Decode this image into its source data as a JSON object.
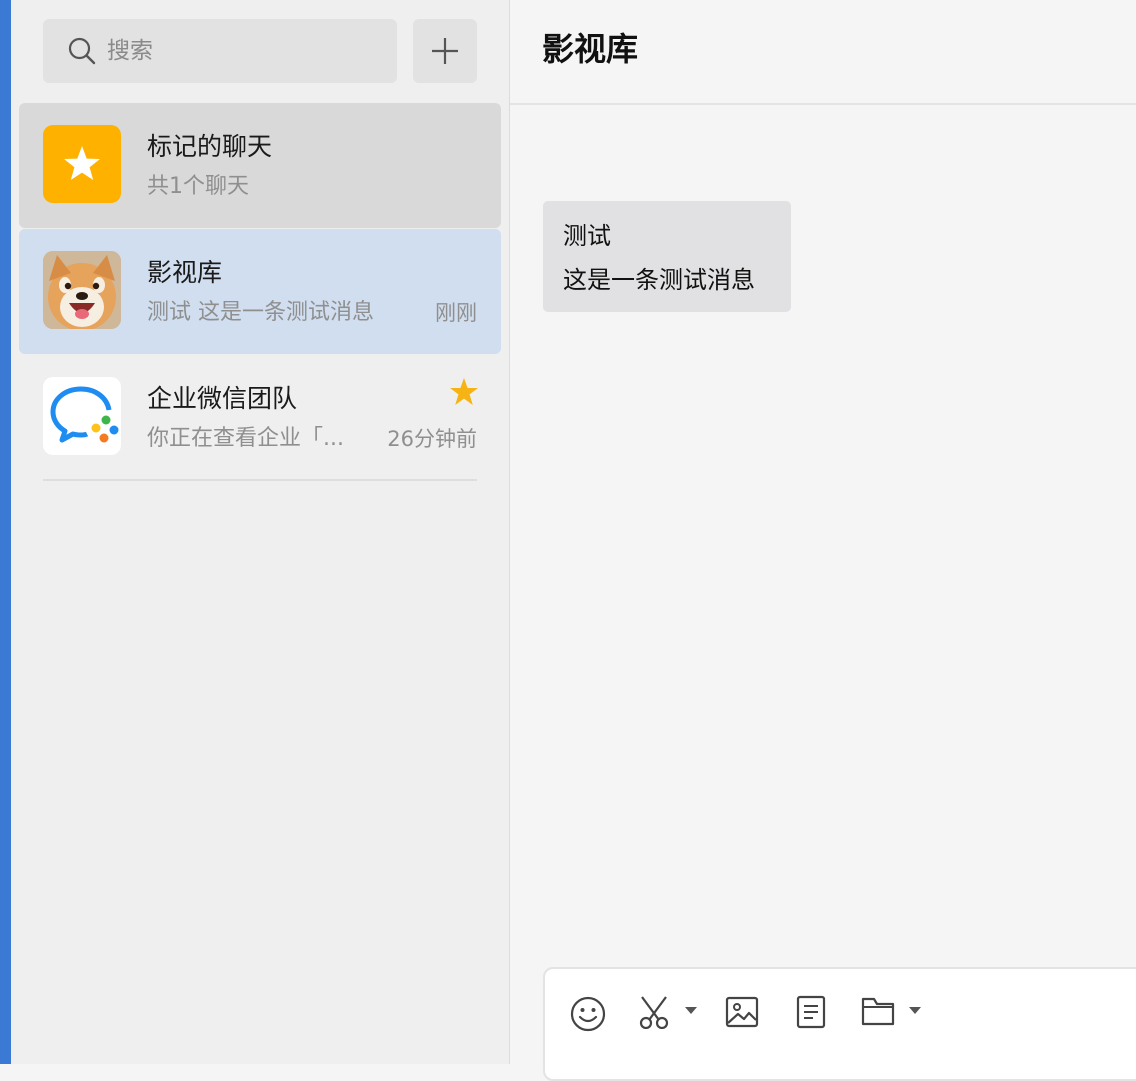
{
  "search": {
    "placeholder": "搜索",
    "icon": "search-icon"
  },
  "add_button": {
    "icon": "plus-icon"
  },
  "conversations": [
    {
      "title": "标记的聊天",
      "subtitle": "共1个聊天",
      "time": "",
      "avatar": "star-folder-icon",
      "avatar_color": "#ffb100",
      "state": "marked"
    },
    {
      "title": "影视库",
      "subtitle": "测试 这是一条测试消息",
      "time": "刚刚",
      "avatar": "shiba-dog-avatar",
      "state": "selected"
    },
    {
      "title": "企业微信团队",
      "subtitle": "你正在查看企业「...",
      "time": "26分钟前",
      "avatar": "wecom-logo",
      "starred": true,
      "star_color": "#f5b414"
    }
  ],
  "chat": {
    "title": "影视库",
    "messages": [
      {
        "lines": [
          "测试",
          "这是一条测试消息"
        ]
      }
    ]
  },
  "toolbar": {
    "icons": [
      "emoji-icon",
      "scissors-icon",
      "chevron-down-icon",
      "image-icon",
      "document-icon",
      "folder-icon",
      "chevron-down-icon"
    ]
  },
  "colors": {
    "accent": "#3a7ad4",
    "selected_row": "#d0deef",
    "marked_row": "#d9d9da"
  }
}
